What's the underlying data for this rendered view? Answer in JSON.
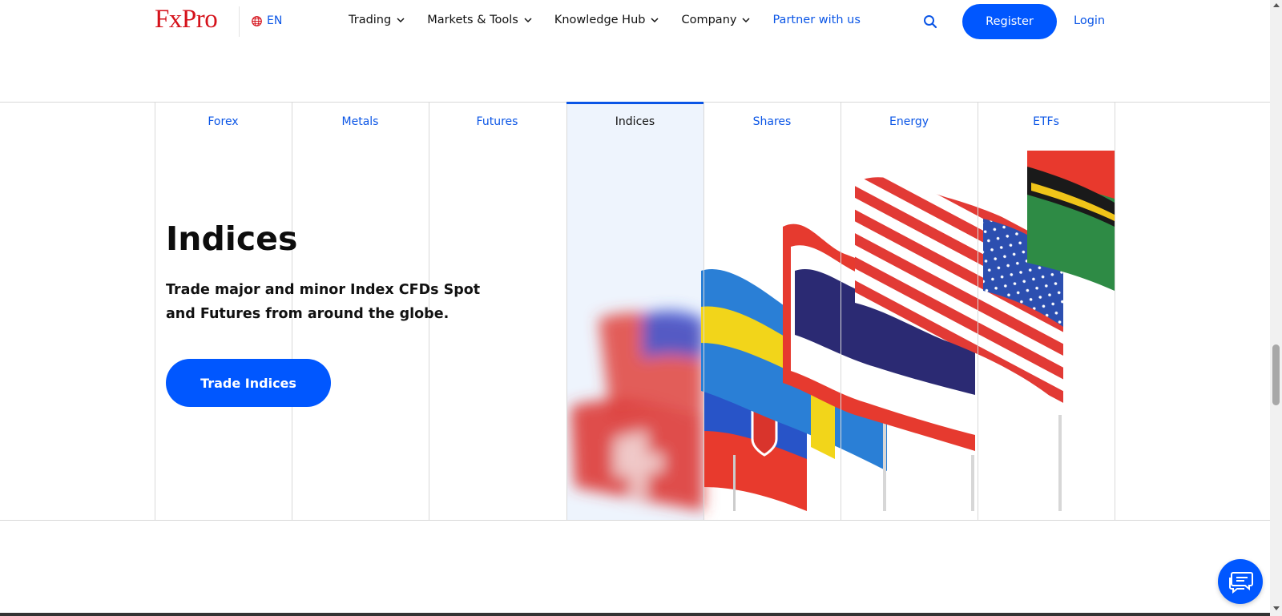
{
  "header": {
    "logo": "FxPro",
    "language": "EN",
    "nav": [
      {
        "label": "Trading"
      },
      {
        "label": "Markets & Tools"
      },
      {
        "label": "Knowledge Hub"
      },
      {
        "label": "Company"
      },
      {
        "label": "Partner with us"
      }
    ],
    "register_label": "Register",
    "login_label": "Login"
  },
  "tabs": [
    {
      "label": "Forex"
    },
    {
      "label": "Metals"
    },
    {
      "label": "Futures"
    },
    {
      "label": "Indices"
    },
    {
      "label": "Shares"
    },
    {
      "label": "Energy"
    },
    {
      "label": "ETFs"
    }
  ],
  "active_tab": "Indices",
  "content": {
    "heading": "Indices",
    "description": "Trade major and minor Index CFDs Spot and Futures from around the globe.",
    "cta_label": "Trade Indices"
  },
  "colors": {
    "brand_red": "#d5121b",
    "accent_blue": "#0057ff",
    "link_blue": "#0a55e6",
    "active_tab_bg": "#eef4fd"
  },
  "icons": [
    "globe-icon",
    "chevron-down-icon",
    "search-icon",
    "chat-icon"
  ]
}
